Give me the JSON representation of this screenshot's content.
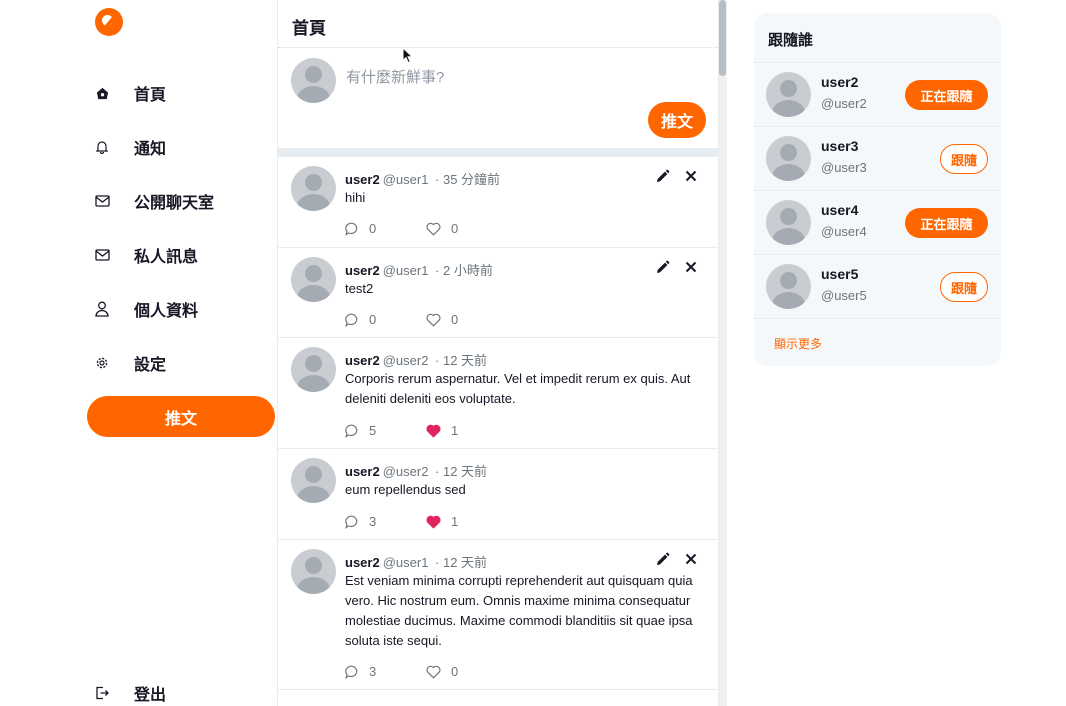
{
  "colors": {
    "accent": "#ff6600",
    "like_active": "#e0245e",
    "muted": "#6c757d"
  },
  "sidebar": {
    "logo": "app-logo",
    "items": [
      {
        "label": "首頁",
        "icon": "home-icon"
      },
      {
        "label": "通知",
        "icon": "bell-icon"
      },
      {
        "label": "公開聊天室",
        "icon": "mail-icon"
      },
      {
        "label": "私人訊息",
        "icon": "mail-icon"
      },
      {
        "label": "個人資料",
        "icon": "user-icon"
      },
      {
        "label": "設定",
        "icon": "gear-icon"
      }
    ],
    "tweet_button": "推文",
    "logout": {
      "label": "登出",
      "icon": "logout-icon"
    }
  },
  "main": {
    "title": "首頁",
    "composer": {
      "placeholder": "有什麼新鮮事?",
      "button": "推文"
    },
    "tweets": [
      {
        "name": "user2",
        "handle": "@user1",
        "time": "· 35 分鐘前",
        "body": "hihi",
        "replies": "0",
        "likes": "0",
        "liked": false,
        "editable": true
      },
      {
        "name": "user2",
        "handle": "@user1",
        "time": "· 2 小時前",
        "body": "test2",
        "replies": "0",
        "likes": "0",
        "liked": false,
        "editable": true
      },
      {
        "name": "user2",
        "handle": "@user2",
        "time": "· 12 天前",
        "body": "Corporis rerum aspernatur. Vel et impedit rerum ex quis. Aut deleniti deleniti eos voluptate.",
        "replies": "5",
        "likes": "1",
        "liked": true,
        "editable": false
      },
      {
        "name": "user2",
        "handle": "@user2",
        "time": "· 12 天前",
        "body": "eum repellendus sed",
        "replies": "3",
        "likes": "1",
        "liked": true,
        "editable": false
      },
      {
        "name": "user2",
        "handle": "@user1",
        "time": "· 12 天前",
        "body": "Est veniam minima corrupti reprehenderit aut quisquam quia vero. Hic nostrum eum. Omnis maxime minima consequatur molestiae ducimus. Maxime commodi blanditiis sit quae ipsa soluta iste sequi.",
        "replies": "3",
        "likes": "0",
        "liked": false,
        "editable": true
      }
    ]
  },
  "follow_panel": {
    "title": "跟隨誰",
    "users": [
      {
        "name": "user2",
        "handle": "@user2",
        "button": "正在跟隨",
        "following": true
      },
      {
        "name": "user3",
        "handle": "@user3",
        "button": "跟隨",
        "following": false
      },
      {
        "name": "user4",
        "handle": "@user4",
        "button": "正在跟隨",
        "following": true
      },
      {
        "name": "user5",
        "handle": "@user5",
        "button": "跟隨",
        "following": false
      }
    ],
    "show_more": "顯示更多"
  }
}
